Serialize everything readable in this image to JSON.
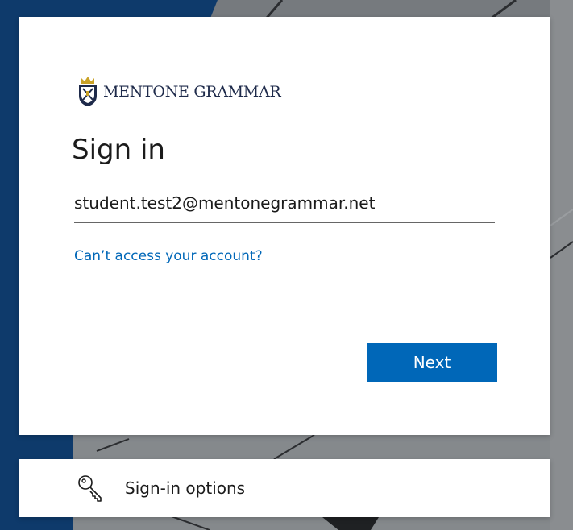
{
  "brand": {
    "name": "MENTONE GRAMMAR"
  },
  "signin": {
    "title": "Sign in",
    "email_value": "student.test2@mentonegrammar.net",
    "help_link": "Can’t access your account?",
    "next_label": "Next"
  },
  "options": {
    "label": "Sign-in options",
    "icon": "key-icon"
  },
  "colors": {
    "accent": "#0067b8",
    "brand_text": "#1e2a4a",
    "card_bg": "#ffffff",
    "background_blue": "#0e3a6b"
  }
}
